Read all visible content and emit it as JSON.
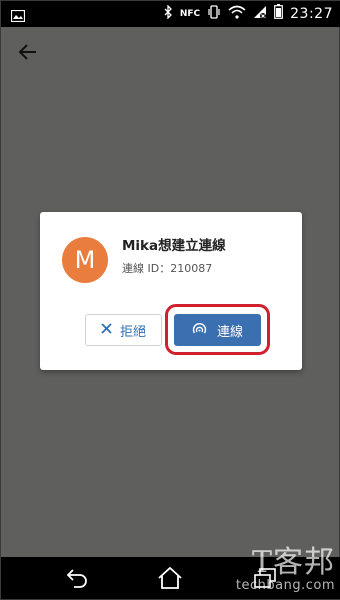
{
  "status_bar": {
    "time": "23:27",
    "nfc_label": "NFC",
    "icons": [
      "photo-icon",
      "bluetooth-icon",
      "nfc-icon",
      "vibrate-icon",
      "wifi-icon",
      "signal-icon",
      "battery-icon"
    ]
  },
  "dialog": {
    "avatar_initial": "M",
    "avatar_color": "#e87d3e",
    "title": "Mika想建立連線",
    "subtitle": "連線 ID：210087",
    "reject_label": "拒絕",
    "connect_label": "連線",
    "highlight_color": "#d0202e",
    "connect_color": "#3a6fb0"
  },
  "watermark": {
    "chinese": "T客邦",
    "english": "techbang.com"
  }
}
